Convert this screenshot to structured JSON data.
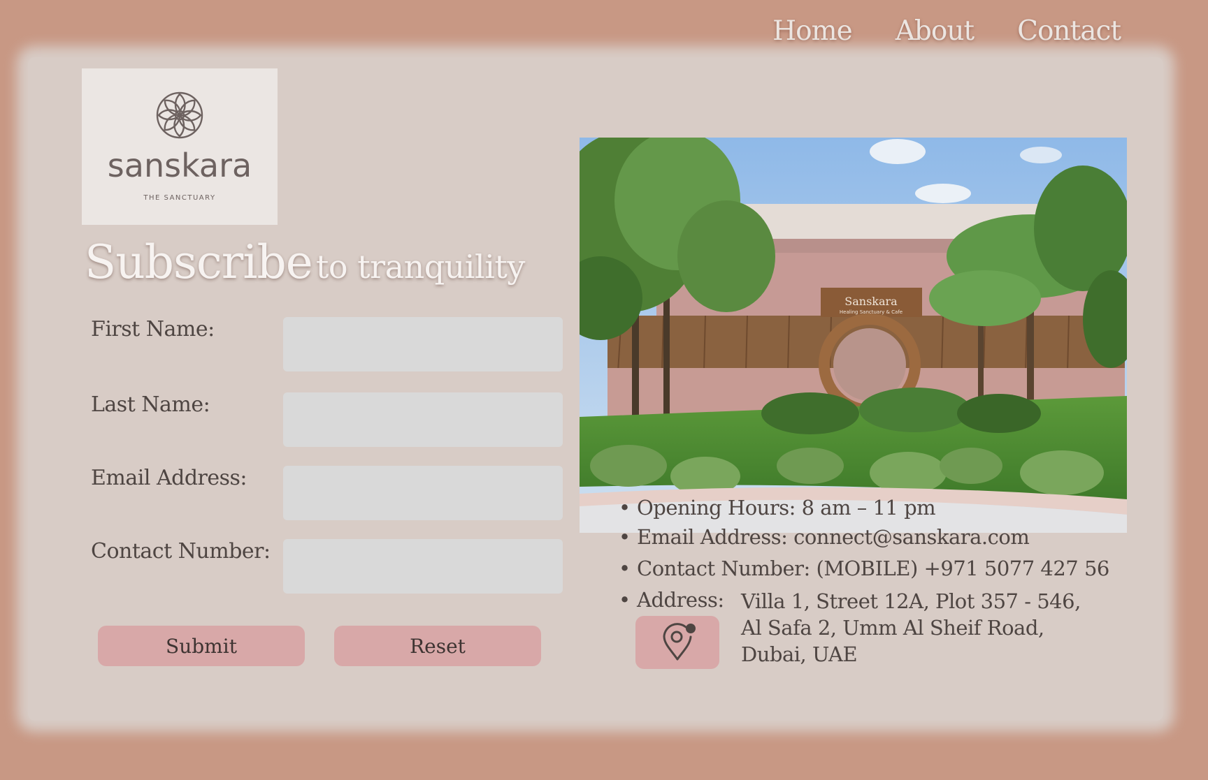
{
  "nav": {
    "items": [
      {
        "label": "Home"
      },
      {
        "label": "About"
      },
      {
        "label": "Contact"
      }
    ]
  },
  "logo": {
    "wordmark": "sanskara",
    "tagline": "THE SANCTUARY"
  },
  "heading": {
    "main": "Subscribe",
    "rest": "to tranquility"
  },
  "form": {
    "first_name_label": "First Name:",
    "last_name_label": "Last Name:",
    "email_label": "Email Address:",
    "contact_label": "Contact Number:",
    "first_name_value": "",
    "last_name_value": "",
    "email_value": "",
    "contact_value": "",
    "submit_label": "Submit",
    "reset_label": "Reset"
  },
  "photo": {
    "sign_text": "Sanskara",
    "sign_subtext": "Healing Sanctuary & Cafe"
  },
  "info": {
    "bullet": "•",
    "opening_hours": "Opening Hours: 8 am – 11 pm",
    "email": "Email Address: connect@sanskara.com",
    "contact": "Contact Number: (MOBILE) +971 5077 427 56",
    "address_label": "Address:",
    "address_lines": [
      "Villa 1, Street 12A, Plot 357 - 546,",
      "Al Safa 2, Umm Al Sheif Road,",
      "Dubai, UAE"
    ],
    "location_icon": "map-pin-icon"
  },
  "colors": {
    "background": "#c89884",
    "card": "#d8ccc6",
    "button": "#d8a8a8",
    "input": "#d9d9d9",
    "text": "#4e4542",
    "nav_text": "#ece6e2"
  }
}
